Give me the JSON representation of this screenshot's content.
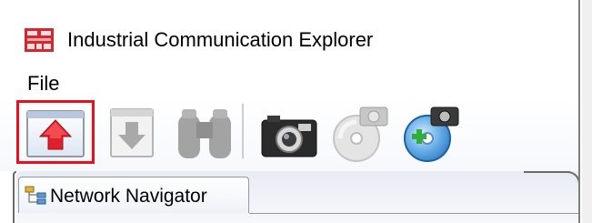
{
  "window": {
    "title": "Industrial Communication Explorer",
    "app_icon": "app-logo-icon"
  },
  "menu": {
    "items": [
      {
        "label": "File"
      }
    ]
  },
  "toolbar": {
    "buttons": [
      {
        "icon": "upload-red-arrow-icon",
        "enabled": true,
        "selected": true
      },
      {
        "icon": "download-arrow-icon",
        "enabled": false
      },
      {
        "icon": "binoculars-icon",
        "enabled": false
      },
      {
        "icon": "camera-icon",
        "enabled": true
      },
      {
        "icon": "disc-camera-icon",
        "enabled": false
      },
      {
        "icon": "disc-camera-add-icon",
        "enabled": true
      }
    ],
    "selection_color": "#e8101e"
  },
  "tabs": [
    {
      "label": "Network Navigator",
      "icon": "network-tree-icon",
      "active": true
    }
  ]
}
